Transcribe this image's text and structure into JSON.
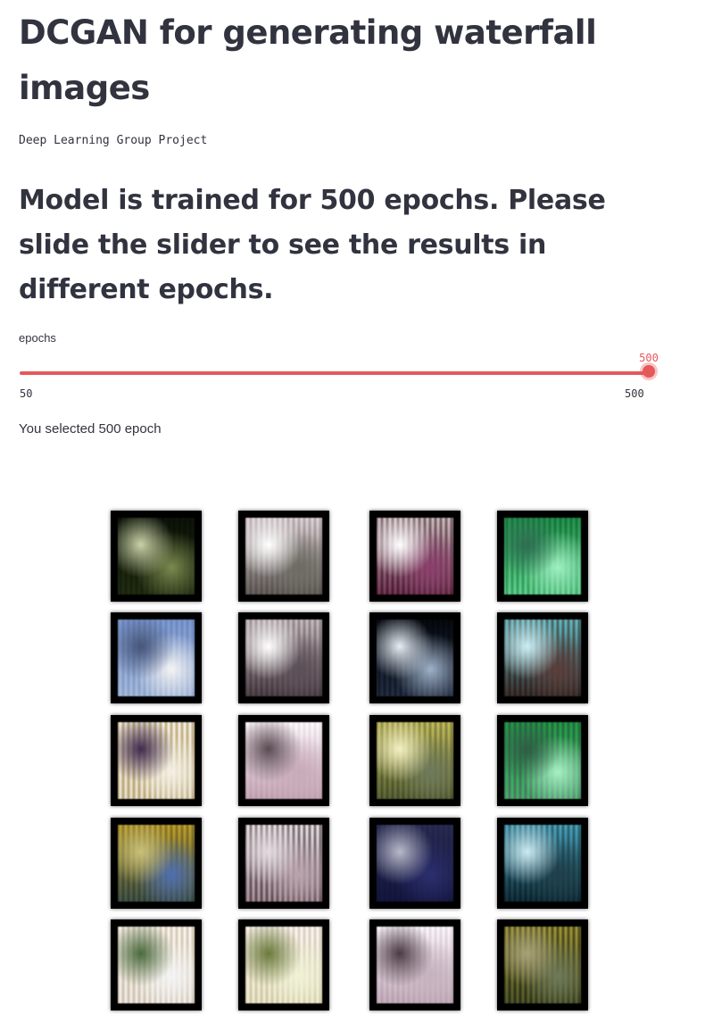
{
  "header": {
    "title": "DCGAN for generating waterfall images",
    "subtitle": "Deep Learning Group Project"
  },
  "main": {
    "heading": "Model is trained for 500 epochs. Please slide the slider to see the results in different epochs.",
    "slider": {
      "label": "epochs",
      "min": 50,
      "max": 500,
      "value": 500,
      "min_label": "50",
      "max_label": "500",
      "value_label": "500",
      "accent_color": "#e5585a"
    },
    "selected_text": "You selected 500 epoch"
  },
  "results": {
    "rows": 5,
    "columns": 4,
    "images": [
      {
        "name": "generated-image-1",
        "tones": [
          "#2f3a24",
          "#7b8a4f",
          "#c9d2a8",
          "#4a5a3a"
        ]
      },
      {
        "name": "generated-image-2",
        "tones": [
          "#f4f1ef",
          "#6d6b63",
          "#ffffff",
          "#b8a8b6"
        ]
      },
      {
        "name": "generated-image-3",
        "tones": [
          "#f1e8ee",
          "#8b3f6b",
          "#ffffff",
          "#6a5a52"
        ]
      },
      {
        "name": "generated-image-4",
        "tones": [
          "#3aa86b",
          "#9ff0c1",
          "#2e6e52",
          "#c2e6d6"
        ]
      },
      {
        "name": "generated-image-5",
        "tones": [
          "#b8c9e8",
          "#f4f4f4",
          "#46557a",
          "#8aa6d0"
        ]
      },
      {
        "name": "generated-image-6",
        "tones": [
          "#e9e4e4",
          "#5c4f57",
          "#ffffff",
          "#9b8f95"
        ]
      },
      {
        "name": "generated-image-7",
        "tones": [
          "#1c2330",
          "#9fb2c9",
          "#e6eef6",
          "#3d4a5e"
        ]
      },
      {
        "name": "generated-image-8",
        "tones": [
          "#9ee8f2",
          "#5a3d3a",
          "#cdeef4",
          "#7a5a4c"
        ]
      },
      {
        "name": "generated-image-9",
        "tones": [
          "#ffffff",
          "#f3efe3",
          "#3f2b4e",
          "#b9a36d"
        ]
      },
      {
        "name": "generated-image-10",
        "tones": [
          "#ffffff",
          "#c7aab8",
          "#5a4a52",
          "#efe3ea"
        ]
      },
      {
        "name": "generated-image-11",
        "tones": [
          "#e8e39a",
          "#6e7a5c",
          "#f4f1c2",
          "#8b8d6d"
        ]
      },
      {
        "name": "generated-image-12",
        "tones": [
          "#4ed47d",
          "#a8f0c6",
          "#2e5e45",
          "#8c6a8c"
        ]
      },
      {
        "name": "generated-image-13",
        "tones": [
          "#e6d36b",
          "#4e6fb0",
          "#c9c07a",
          "#8a7e4e"
        ]
      },
      {
        "name": "generated-image-14",
        "tones": [
          "#ffffff",
          "#b9a3ad",
          "#e3dbdf",
          "#6a5860"
        ]
      },
      {
        "name": "generated-image-15",
        "tones": [
          "#5c5f8f",
          "#2b2f6e",
          "#b8b9c9",
          "#7a7c8a"
        ]
      },
      {
        "name": "generated-image-16",
        "tones": [
          "#8fd6e8",
          "#1f3f4a",
          "#cdebf2",
          "#4a6a6e"
        ]
      },
      {
        "name": "generated-image-17",
        "tones": [
          "#ffffff",
          "#f4f4f4",
          "#4b6a3e",
          "#d3c1a8"
        ]
      },
      {
        "name": "generated-image-18",
        "tones": [
          "#ffffff",
          "#f0f2d6",
          "#6b7a3c",
          "#d9c9b8"
        ]
      },
      {
        "name": "generated-image-19",
        "tones": [
          "#ffffff",
          "#c6b2bf",
          "#4a3a44",
          "#e6d9e2"
        ]
      },
      {
        "name": "generated-image-20",
        "tones": [
          "#d6cf7a",
          "#6e7a5a",
          "#a8a27a",
          "#4a4a3a"
        ]
      }
    ]
  }
}
